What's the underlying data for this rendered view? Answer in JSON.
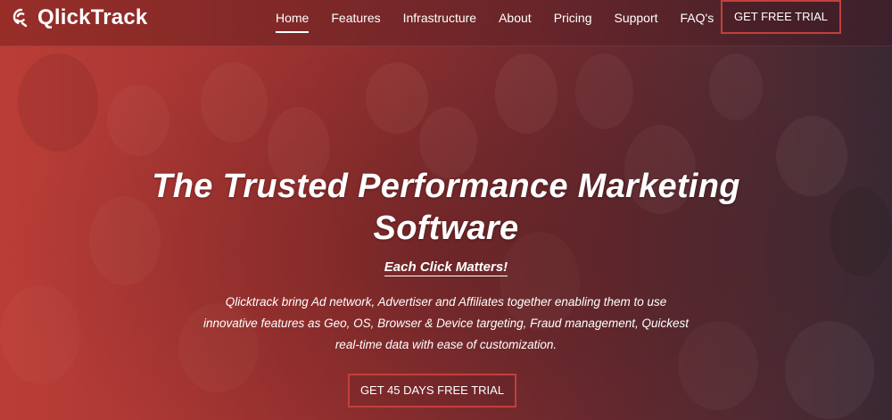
{
  "brand": {
    "name": "QlickTrack",
    "logo_icon": "qlicktrack-swirl-icon"
  },
  "nav": {
    "items": [
      {
        "label": "Home",
        "active": true
      },
      {
        "label": "Features",
        "active": false
      },
      {
        "label": "Infrastructure",
        "active": false
      },
      {
        "label": "About",
        "active": false
      },
      {
        "label": "Pricing",
        "active": false
      },
      {
        "label": "Support",
        "active": false
      },
      {
        "label": "FAQ's",
        "active": false
      }
    ],
    "cta_label": "GET FREE TRIAL"
  },
  "hero": {
    "headline_line1": "The Trusted Performance Marketing",
    "headline_line2": "Software",
    "tagline": "Each Click Matters!",
    "description_line1": "Qlicktrack bring Ad network, Advertiser and Affiliates together enabling them to use",
    "description_line2": "innovative features as Geo, OS, Browser & Device targeting, Fraud management, Quickest",
    "description_line3": "real-time data with ease of customization.",
    "cta_label": "GET 45 DAYS FREE TRIAL"
  },
  "colors": {
    "accent_border": "#c2403a",
    "hero_left": "#b8413b",
    "hero_right": "#3d2a33"
  }
}
